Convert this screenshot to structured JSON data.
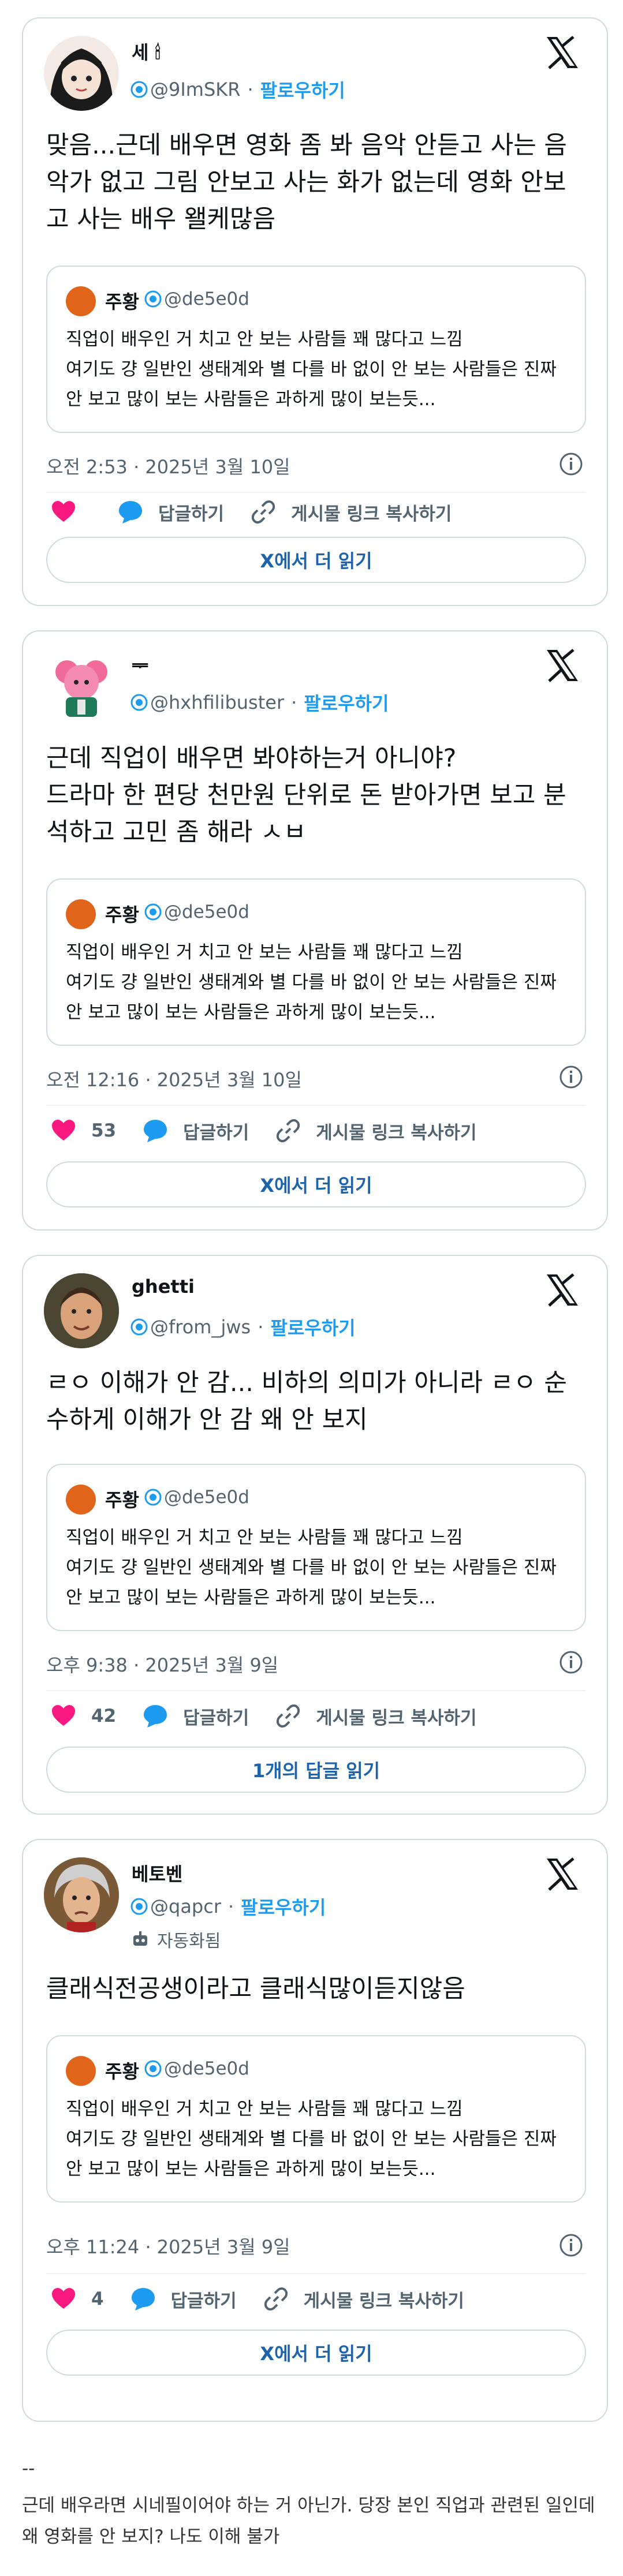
{
  "common": {
    "follow_label": "팔로우하기",
    "reply_label": "답글하기",
    "copy_link_label": "게시물 링크 복사하기",
    "separator": "·"
  },
  "quote": {
    "name": "주황",
    "handle": "@de5e0d",
    "text": "직업이 배우인 거 치고 안 보는 사람들 꽤 많다고 느낌\n여기도 걍 일반인 생태계와 별 다를 바 없이 안 보는 사람들은 진짜 안 보고 많이 보는 사람들은 과하게 많이 보는듯..."
  },
  "tweets": [
    {
      "name": "세 🕯",
      "handle": "@9ImSKR",
      "text": "맞음...근데 배우면 영화 좀 봐 음악 안듣고 사는 음악가 없고 그림 안보고 사는 화가 없는데 영화 안보고 사는 배우 왤케많음",
      "timestamp": "오전 2:53 · 2025년 3월 10일",
      "likes": "",
      "button_label": "X에서 더 읽기"
    },
    {
      "name": "ᆕ",
      "handle": "@hxhfilibuster",
      "text": "근데 직업이 배우면 봐야하는거 아니야?\n드라마 한 편당 천만원 단위로 돈 받아가면 보고 분석하고 고민 좀 해라 ㅅㅂ",
      "timestamp": "오전 12:16 · 2025년 3월 10일",
      "likes": "53",
      "button_label": "X에서 더 읽기"
    },
    {
      "name": "ghetti",
      "handle": "@from_jws",
      "text": "ㄹㅇ 이해가 안 감... 비하의 의미가 아니라 ㄹㅇ 순수하게 이해가 안 감 왜 안 보지",
      "timestamp": "오후 9:38 · 2025년 3월 9일",
      "likes": "42",
      "button_label": "1개의 답글 읽기"
    },
    {
      "name": "베토벤",
      "handle": "@qapcr",
      "auto_label": "자동화됨",
      "text": "클래식전공생이라고 클래식많이듣지않음",
      "timestamp": "오후 11:24 · 2025년 3월 9일",
      "likes": "4",
      "button_label": "X에서 더 읽기"
    }
  ],
  "footer": {
    "dash": "--",
    "text": "근데 배우라면 시네필이어야 하는 거 아닌가. 당장 본인 직업과 관련된 일인데 왜 영화를 안 보지? 나도 이해 불가"
  },
  "colors": {
    "like": "#f91880",
    "reply": "#1d9bf0",
    "accent": "#1d9bf0",
    "border": "#cfd9de"
  }
}
